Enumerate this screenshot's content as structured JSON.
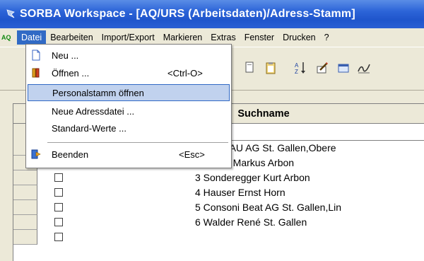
{
  "window": {
    "title": "SORBA Workspace - [AQ/URS (Arbeitsdaten)/Adress-Stamm]"
  },
  "menubar": {
    "app_icon_text": "AQ",
    "items": [
      {
        "label": "Datei",
        "active": true
      },
      {
        "label": "Bearbeiten"
      },
      {
        "label": "Import/Export"
      },
      {
        "label": "Markieren"
      },
      {
        "label": "Extras"
      },
      {
        "label": "Fenster"
      },
      {
        "label": "Drucken"
      },
      {
        "label": "?"
      }
    ]
  },
  "datei_menu": {
    "items": [
      {
        "label": "Neu ...",
        "icon": "new-file-icon",
        "shortcut": ""
      },
      {
        "label": "Öffnen ...",
        "icon": "open-book-icon",
        "shortcut": "<Ctrl-O>"
      },
      {
        "label": "Personalstamm öffnen",
        "icon": "",
        "shortcut": "",
        "highlighted": true
      },
      {
        "label": "Neue Adressdatei ...",
        "icon": "",
        "shortcut": ""
      },
      {
        "label": "Standard-Werte ...",
        "icon": "",
        "shortcut": ""
      },
      {
        "label": "Beenden",
        "icon": "exit-icon",
        "shortcut": "<Esc>"
      }
    ]
  },
  "toolbar": {
    "icons": [
      "document-icon",
      "clipboard-icon",
      "sort-az-icon",
      "edit-icon",
      "table-icon",
      "signature-icon"
    ]
  },
  "grid": {
    "column_header": "Suchname",
    "rows": [
      {
        "text": "ter BAU AG St. Gallen,Obere"
      },
      {
        "text": "2 Müller Markus Arbon"
      },
      {
        "text": "3 Sonderegger Kurt Arbon"
      },
      {
        "text": "4 Hauser Ernst Horn"
      },
      {
        "text": "5 Consoni Beat AG St. Gallen,Lin"
      },
      {
        "text": "6 Walder René St. Gallen"
      }
    ]
  },
  "colors": {
    "titlebar": "#2c64d8",
    "menu_highlight": "#316ac5",
    "dropdown_highlight": "#c1d2ee"
  }
}
